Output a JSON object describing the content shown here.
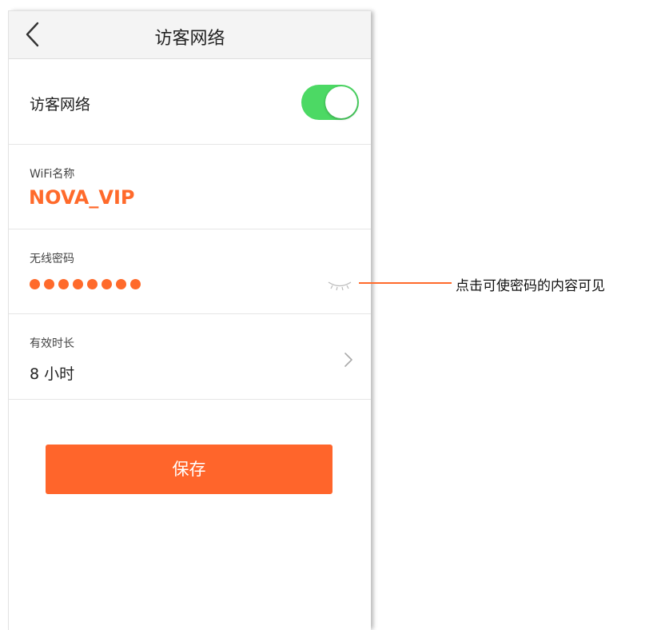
{
  "nav": {
    "title": "访客网络",
    "back_icon": "chevron-left-icon"
  },
  "guest": {
    "label": "访客网络",
    "toggle_on": true,
    "toggle_color": "#4cd964"
  },
  "wifi": {
    "label": "WiFi名称",
    "value": "NOVA_VIP"
  },
  "password": {
    "label": "无线密码",
    "masked_length": 8,
    "eye_icon": "eye-closed-icon"
  },
  "duration": {
    "label": "有效时长",
    "value": "8 小时",
    "arrow_icon": "chevron-right-icon"
  },
  "save_label": "保存",
  "annotation": {
    "text": "点击可使密码的内容可见"
  },
  "colors": {
    "accent": "#ff6a2b",
    "toggle": "#4cd964"
  }
}
